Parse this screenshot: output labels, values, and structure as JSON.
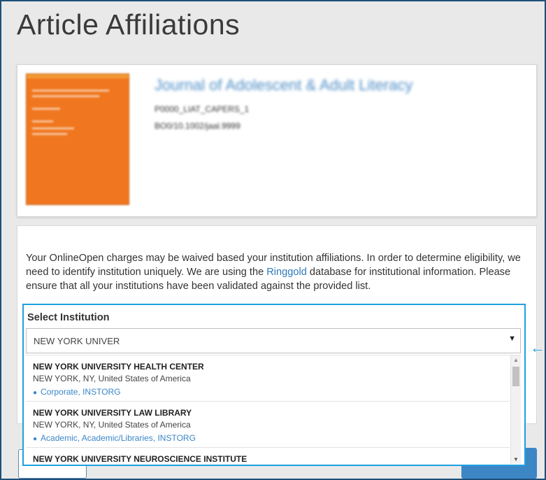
{
  "page": {
    "title": "Article Affiliations"
  },
  "article": {
    "journal_title": "Journal of Adolescent & Adult Literacy",
    "article_id": "P0000_LIAT_CAPERS_1",
    "doi": "BO0/10.1002/jaal.9999"
  },
  "affiliations": {
    "intro_before_link": "Your OnlineOpen charges may be waived based your institution affiliations. In order to determine eligibility, we need to identify institution uniquely. We are using the ",
    "link_text": "Ringgold",
    "intro_after_link": " database for institutional information. Please ensure that all your institutions have been validated against the provided list.",
    "select_label": "Select Institution",
    "search_value": "NEW YORK UNIVER",
    "results": [
      {
        "name": "NEW YORK UNIVERSITY HEALTH CENTER",
        "location": "NEW YORK, NY, United States of America",
        "tags": "Corporate, INSTORG"
      },
      {
        "name": "NEW YORK UNIVERSITY LAW LIBRARY",
        "location": "NEW YORK, NY, United States of America",
        "tags": "Academic, Academic/Libraries, INSTORG"
      },
      {
        "name": "NEW YORK UNIVERSITY NEUROSCIENCE INSTITUTE",
        "location": "",
        "tags": ""
      }
    ]
  },
  "icons": {
    "dropdown": "caret-down-icon",
    "tag": "tag-icon",
    "pointer": "arrow-left-icon"
  },
  "colors": {
    "highlight": "#1ea0e0",
    "link": "#2f78b7",
    "cover": "#f0771f",
    "primary_button": "#3c86c6"
  }
}
